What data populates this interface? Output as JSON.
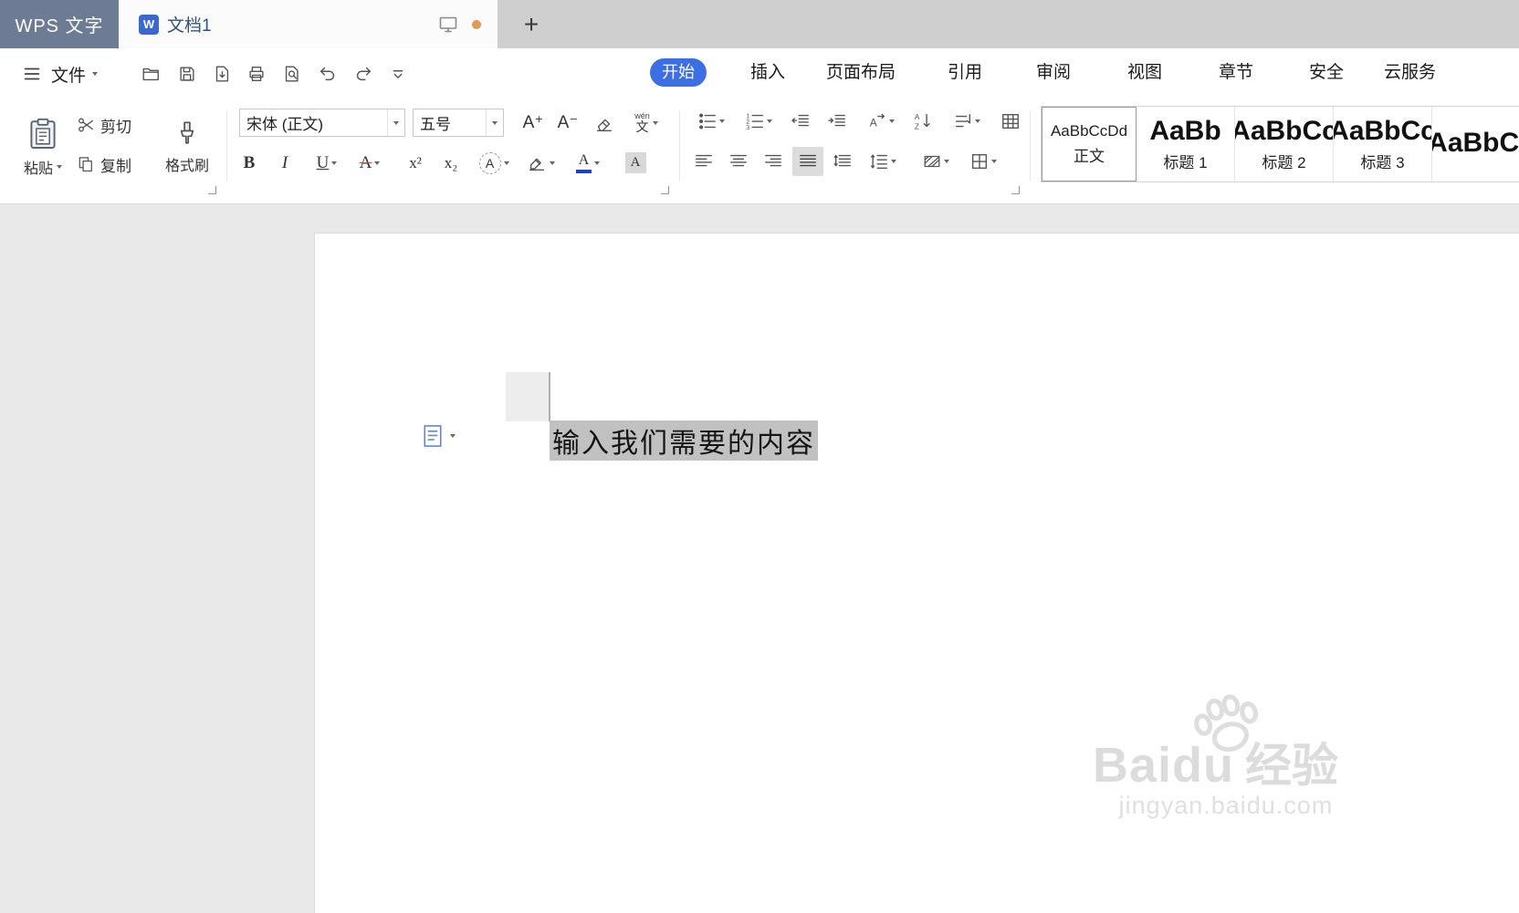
{
  "colors": {
    "accent": "#3d6fe4",
    "app_badge": "#6d7c94",
    "selection": "#c1c1c1"
  },
  "titlebar": {
    "app_name": "WPS 文字",
    "doc_icon_letter": "W",
    "document_tab": "文档1",
    "new_tab_label": "+"
  },
  "menubar": {
    "file_label": "文件"
  },
  "ribbon_tabs": {
    "active": "开始",
    "items": [
      {
        "label": "开始"
      },
      {
        "label": "插入"
      },
      {
        "label": "页面布局"
      },
      {
        "label": "引用"
      },
      {
        "label": "审阅"
      },
      {
        "label": "视图"
      },
      {
        "label": "章节"
      },
      {
        "label": "安全"
      },
      {
        "label": "云服务"
      }
    ]
  },
  "clipboard_group": {
    "paste_label": "粘贴",
    "cut_label": "剪切",
    "copy_label": "复制",
    "format_painter_label": "格式刷"
  },
  "font_group": {
    "family_value": "宋体 (正文)",
    "size_value": "五号",
    "grow_label": "A⁺",
    "shrink_label": "A⁻",
    "pinyin_top": "wén",
    "pinyin_label": "文",
    "bold_label": "B",
    "italic_label": "I",
    "underline_label": "U",
    "strike_label": "A",
    "superscript_label": "x²",
    "subscript_label": "x₂",
    "effect_label": "A",
    "font_color_label": "A",
    "char_shading_label": "A"
  },
  "styles_gallery": {
    "items": [
      {
        "preview": "AaBbCcDd",
        "label": "正文",
        "selected": true
      },
      {
        "preview": "AaBb",
        "label": "标题 1",
        "selected": false
      },
      {
        "preview": "AaBbCc",
        "label": "标题 2",
        "selected": false
      },
      {
        "preview": "AaBbCc",
        "label": "标题 3",
        "selected": false
      },
      {
        "preview": "AaBbCc",
        "label": "",
        "selected": false
      }
    ]
  },
  "document": {
    "selected_text": "输入我们需要的内容"
  },
  "watermark": {
    "brand": "Baidu",
    "brand_cn": "经验",
    "url": "jingyan.baidu.com"
  }
}
